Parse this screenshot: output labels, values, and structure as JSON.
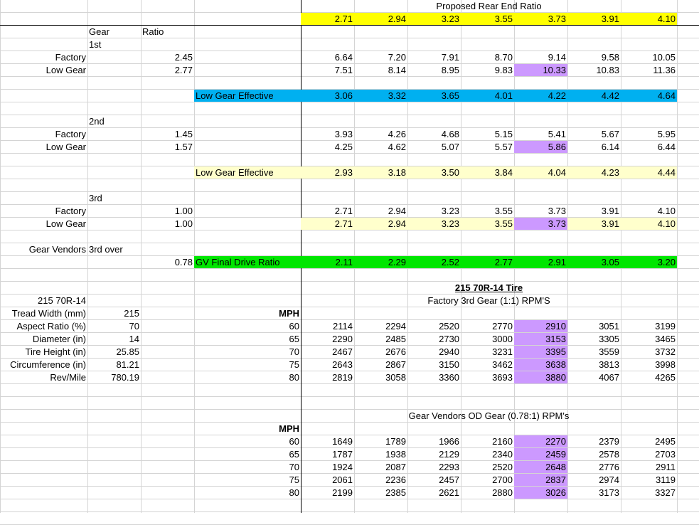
{
  "colors": {
    "yellow": "#ffff00",
    "cyan": "#00b0f0",
    "cream": "#ffffcc",
    "green": "#00e600",
    "purple": "#cc99ff",
    "grid": "#d4d4d4"
  },
  "header": {
    "title": "Proposed Rear End Ratio",
    "ratios": [
      "2.71",
      "2.94",
      "3.23",
      "3.55",
      "3.73",
      "3.91",
      "4.10"
    ]
  },
  "labels": {
    "gear": "Gear",
    "ratio": "Ratio",
    "factory": "Factory",
    "low_gear": "Low Gear",
    "first": "1st",
    "second": "2nd",
    "third": "3rd",
    "gv_label": "Gear Vendors",
    "third_over": "3rd over",
    "gv_ratio": "0.78",
    "mph": "MPH"
  },
  "first_gear": {
    "factory_ratio": "2.45",
    "low_ratio": "2.77",
    "factory": [
      "6.64",
      "7.20",
      "7.91",
      "8.70",
      "9.14",
      "9.58",
      "10.05"
    ],
    "low": [
      "7.51",
      "8.14",
      "8.95",
      "9.83",
      "10.33",
      "10.83",
      "11.36"
    ],
    "effective_label": "Low Gear Effective",
    "effective": [
      "3.06",
      "3.32",
      "3.65",
      "4.01",
      "4.22",
      "4.42",
      "4.64"
    ]
  },
  "second_gear": {
    "factory_ratio": "1.45",
    "low_ratio": "1.57",
    "factory": [
      "3.93",
      "4.26",
      "4.68",
      "5.15",
      "5.41",
      "5.67",
      "5.95"
    ],
    "low": [
      "4.25",
      "4.62",
      "5.07",
      "5.57",
      "5.86",
      "6.14",
      "6.44"
    ],
    "effective_label": "Low Gear Effective",
    "effective": [
      "2.93",
      "3.18",
      "3.50",
      "3.84",
      "4.04",
      "4.23",
      "4.44"
    ]
  },
  "third_gear": {
    "factory_ratio": "1.00",
    "low_ratio": "1.00",
    "factory": [
      "2.71",
      "2.94",
      "3.23",
      "3.55",
      "3.73",
      "3.91",
      "4.10"
    ],
    "low": [
      "2.71",
      "2.94",
      "3.23",
      "3.55",
      "3.73",
      "3.91",
      "4.10"
    ]
  },
  "gv": {
    "label": "GV Final Drive Ratio",
    "values": [
      "2.11",
      "2.29",
      "2.52",
      "2.77",
      "2.91",
      "3.05",
      "3.20"
    ]
  },
  "tire": {
    "name": "215 70R-14",
    "heading": "215 70R-14 Tire",
    "sub_heading": "Factory 3rd Gear (1:1) RPM'S",
    "specs": [
      {
        "label": "Tread Width (mm)",
        "value": "215"
      },
      {
        "label": "Aspect Ratio (%)",
        "value": "70"
      },
      {
        "label": "Diameter (in)",
        "value": "14"
      },
      {
        "label": "Tire Height (in)",
        "value": "25.85"
      },
      {
        "label": "Circumference (in)",
        "value": "81.21"
      },
      {
        "label": "Rev/Mile",
        "value": "780.19"
      }
    ]
  },
  "rpm_factory": {
    "mph": [
      "60",
      "65",
      "70",
      "75",
      "80"
    ],
    "rows": [
      [
        "2114",
        "2294",
        "2520",
        "2770",
        "2910",
        "3051",
        "3199"
      ],
      [
        "2290",
        "2485",
        "2730",
        "3000",
        "3153",
        "3305",
        "3465"
      ],
      [
        "2467",
        "2676",
        "2940",
        "3231",
        "3395",
        "3559",
        "3732"
      ],
      [
        "2643",
        "2867",
        "3150",
        "3462",
        "3638",
        "3813",
        "3998"
      ],
      [
        "2819",
        "3058",
        "3360",
        "3693",
        "3880",
        "4067",
        "4265"
      ]
    ]
  },
  "rpm_gv": {
    "heading": "Gear Vendors OD Gear (0.78:1) RPM's",
    "mph": [
      "60",
      "65",
      "70",
      "75",
      "80"
    ],
    "rows": [
      [
        "1649",
        "1789",
        "1966",
        "2160",
        "2270",
        "2379",
        "2495"
      ],
      [
        "1787",
        "1938",
        "2129",
        "2340",
        "2459",
        "2578",
        "2703"
      ],
      [
        "1924",
        "2087",
        "2293",
        "2520",
        "2648",
        "2776",
        "2911"
      ],
      [
        "2061",
        "2236",
        "2457",
        "2700",
        "2837",
        "2974",
        "3119"
      ],
      [
        "2199",
        "2385",
        "2621",
        "2880",
        "3026",
        "3173",
        "3327"
      ]
    ]
  }
}
